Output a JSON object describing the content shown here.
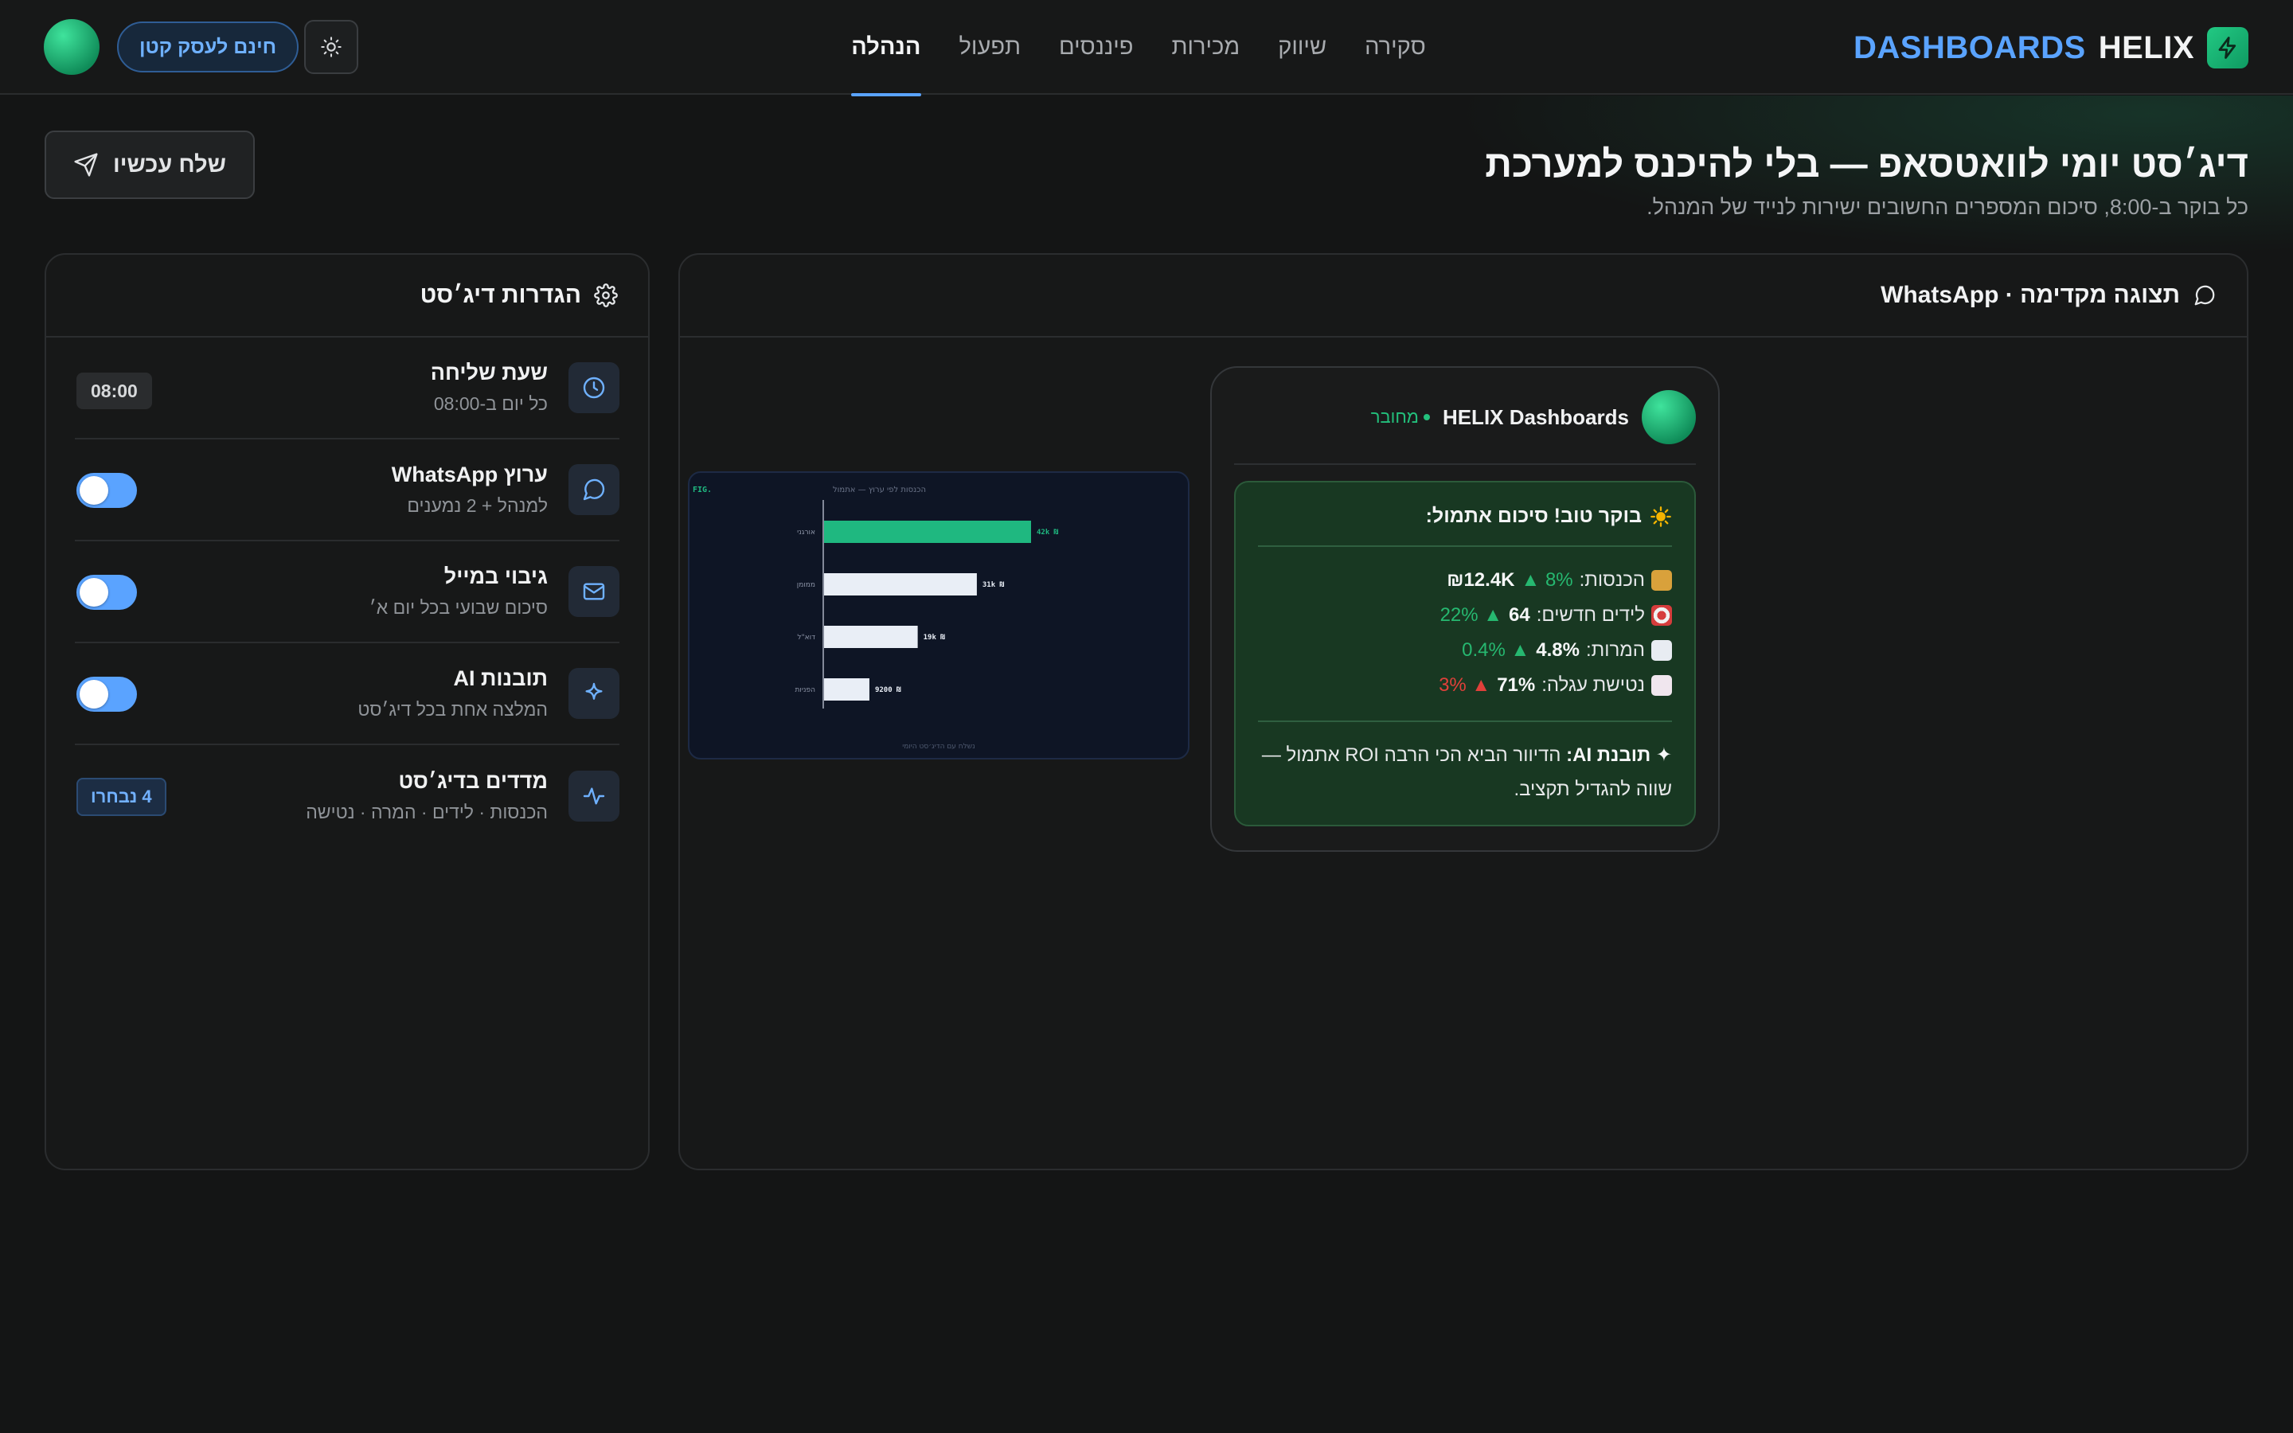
{
  "brand": {
    "name": "HELIX",
    "suffix": "DASHBOARDS",
    "logo_icon": "bolt-icon",
    "accent": "#5aa3ff",
    "logo_color": "#22c983"
  },
  "nav": {
    "items": [
      {
        "label": "סקירה",
        "active": false
      },
      {
        "label": "שיווק",
        "active": false
      },
      {
        "label": "מכירות",
        "active": false
      },
      {
        "label": "פיננסים",
        "active": false
      },
      {
        "label": "תפעול",
        "active": false
      },
      {
        "label": "הנהלה",
        "active": true
      }
    ]
  },
  "header_actions": {
    "theme_icon": "sun-icon",
    "plan_label": "חינם לעסק קטן"
  },
  "hero": {
    "title": "דיג׳סט יומי לוואטסאפ — בלי להיכנס למערכת",
    "subtitle": "כל בוקר ב-8:00, סיכום המספרים החשובים ישירות לנייד של המנהל.",
    "send_label": "שלח עכשיו"
  },
  "settings": {
    "title": "הגדרות דיג׳סט",
    "rows": [
      {
        "title": "שעת שליחה",
        "desc": "כל יום ב-08:00",
        "value": "08:00",
        "icon": "clock-icon"
      },
      {
        "title": "ערוץ WhatsApp",
        "desc": "למנהל + 2 נמענים",
        "toggle_on": true,
        "icon": "chat-icon"
      },
      {
        "title": "גיבוי במייל",
        "desc": "סיכום שבועי בכל יום א׳",
        "toggle_on": true,
        "icon": "mail-icon"
      },
      {
        "title": "תובנות AI",
        "desc": "המלצה אחת בכל דיג׳סט",
        "toggle_on": true,
        "icon": "sparkle-icon"
      },
      {
        "title": "מדדים בדיג׳סט",
        "desc": "הכנסות · לידים · המרה · נטישה",
        "value": "4 נבחרו",
        "icon": "pulse-icon"
      }
    ]
  },
  "preview": {
    "title": "תצוגה מקדימה · WhatsApp",
    "contact_name": "HELIX Dashboards",
    "contact_status": "מחובר",
    "greeting": "בוקר טוב! סיכום אתמול:",
    "kpis": [
      {
        "label": "הכנסות:",
        "value": "₪12.4K",
        "change": "8%",
        "trend": "up"
      },
      {
        "label": "לידים חדשים:",
        "value": "64",
        "change": "22%",
        "trend": "up"
      },
      {
        "label": "המרות:",
        "value": "4.8%",
        "change": "0.4%",
        "trend": "up"
      },
      {
        "label": "נטישת עגלה:",
        "value": "71%",
        "change": "3%",
        "trend": "bad"
      }
    ],
    "ai_label": "תובנת AI:",
    "ai_text": "הדיוור הביא הכי הרבה ROI אתמול — שווה להגדיל תקציב."
  },
  "chart_data": {
    "type": "bar",
    "orientation": "horizontal",
    "fig_label": "FIG.",
    "title": "הכנסות לפי ערוץ — אתמול",
    "categories": [
      "אורגני",
      "ממומן",
      "דוא\"ל",
      "הפניות"
    ],
    "values": [
      42000,
      31000,
      19000,
      9200
    ],
    "value_labels": [
      "42k ₪",
      "31k ₪",
      "19k ₪",
      "9200 ₪"
    ],
    "highlight_color": "#1fb880",
    "bar_color": "#e9eef6",
    "footer": "נשלח עם הדיג׳סט היומי"
  }
}
